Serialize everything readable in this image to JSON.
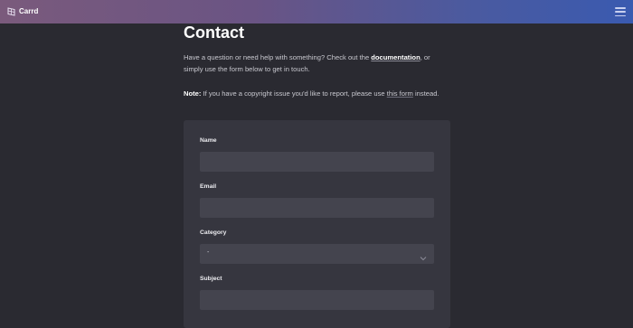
{
  "header": {
    "brand": "Carrd",
    "logo_icon": "carrd-logo-icon",
    "menu_icon": "hamburger-menu-icon"
  },
  "page": {
    "title": "Contact",
    "intro_before": "Have a question or need help with something? Check out the ",
    "intro_link": "documentation",
    "intro_after": ", or simply use the form below to get in touch.",
    "note_label": "Note:",
    "note_before": " If you have a copyright issue you'd like to report, please use ",
    "note_link": "this form",
    "note_after": " instead."
  },
  "form": {
    "name_label": "Name",
    "name_value": "",
    "email_label": "Email",
    "email_value": "",
    "category_label": "Category",
    "category_value": "-",
    "subject_label": "Subject",
    "subject_value": ""
  },
  "colors": {
    "background": "#2a2a31",
    "card": "#36363f",
    "input": "#44444e",
    "header_gradient_start": "#7a5a7c",
    "header_gradient_end": "#3a5ab0"
  }
}
